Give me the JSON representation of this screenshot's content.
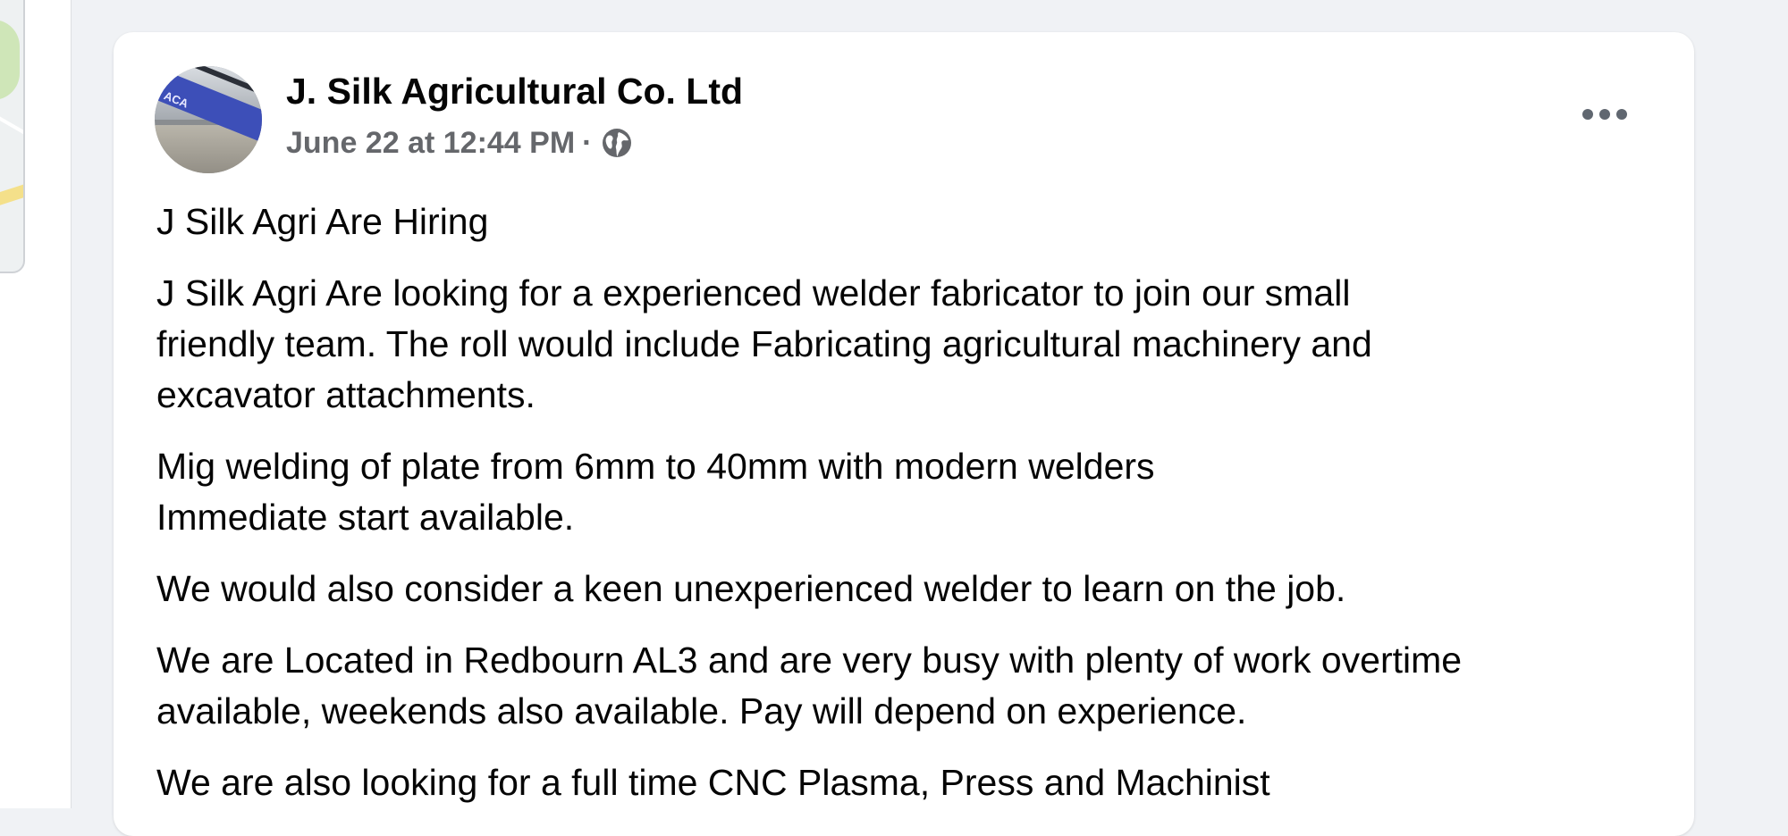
{
  "post": {
    "author": "J. Silk Agricultural Co. Ltd",
    "avatar_alt": "ACA",
    "timestamp": "June 22 at 12:44 PM",
    "separator": "·",
    "privacy_icon": "globe-icon",
    "more_icon": "more-options-icon",
    "paragraphs": [
      "J Silk Agri Are Hiring",
      "J Silk Agri Are looking for a experienced welder fabricator to join our small\nfriendly team. The roll would include Fabricating agricultural machinery and\nexcavator attachments.",
      "Mig welding of plate from 6mm to 40mm with modern welders\nImmediate start available.",
      "We would also consider a keen unexperienced welder to learn on the job.",
      "We are Located in Redbourn AL3 and are very busy with plenty of work overtime\navailable, weekends also available. Pay will depend on experience.",
      "We are also looking for a full time CNC Plasma, Press and Machinist"
    ]
  },
  "colors": {
    "background": "#f0f2f5",
    "card": "#ffffff",
    "primary_text": "#050505",
    "secondary_text": "#65676b"
  }
}
